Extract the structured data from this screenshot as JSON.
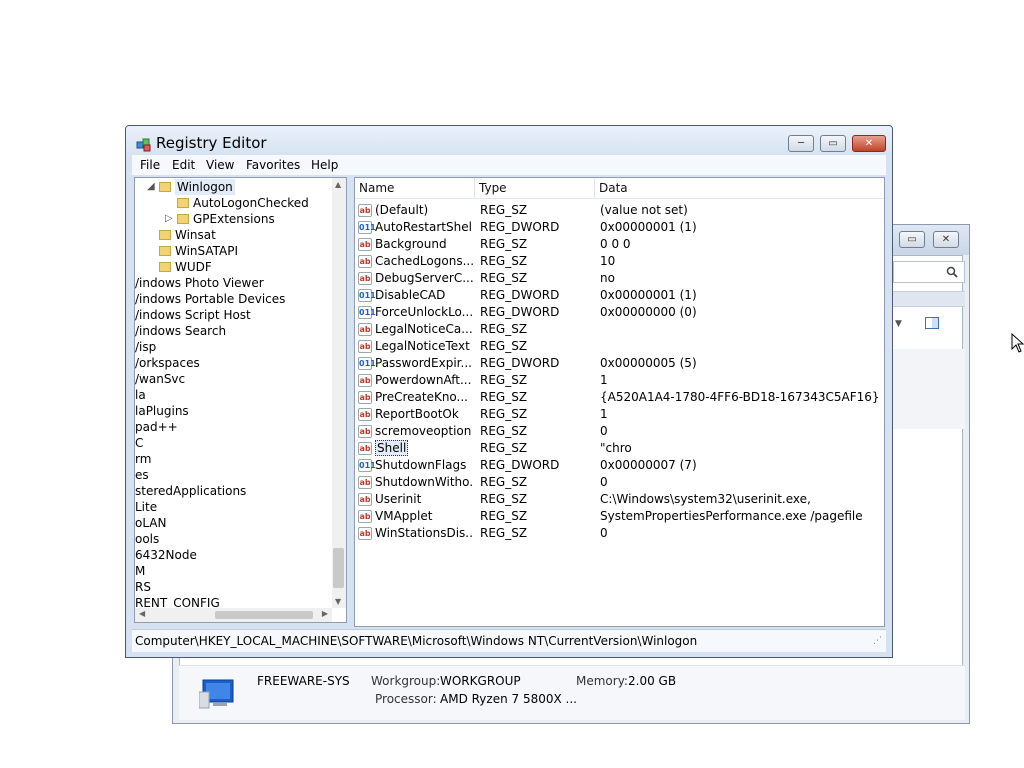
{
  "background_window": {
    "buttons": [
      "▭",
      "✕"
    ],
    "computer_name": "FREEWARE-SYS",
    "workgroup_label": "Workgroup:",
    "workgroup_value": "WORKGROUP",
    "memory_label": "Memory:",
    "memory_value": "2.00 GB",
    "processor_label": "Processor:",
    "processor_value": "AMD Ryzen 7 5800X ..."
  },
  "registry_editor": {
    "title": "Registry Editor",
    "title_buttons": [
      "─",
      "▭",
      "✕"
    ],
    "menu": [
      "File",
      "Edit",
      "View",
      "Favorites",
      "Help"
    ],
    "tree": [
      {
        "label": "Winlogon",
        "indent": 1,
        "folder": true,
        "expanded": true,
        "selected": true
      },
      {
        "label": "AutoLogonChecked",
        "indent": 2,
        "folder": true
      },
      {
        "label": "GPExtensions",
        "indent": 2,
        "folder": true,
        "collapsed": true
      },
      {
        "label": "Winsat",
        "indent": 1,
        "folder": true
      },
      {
        "label": "WinSATAPI",
        "indent": 1,
        "folder": true
      },
      {
        "label": "WUDF",
        "indent": 1,
        "folder": true
      },
      {
        "label": "/indows Photo Viewer",
        "indent": 0
      },
      {
        "label": "/indows Portable Devices",
        "indent": 0
      },
      {
        "label": "/indows Script Host",
        "indent": 0
      },
      {
        "label": "/indows Search",
        "indent": 0
      },
      {
        "label": "/isp",
        "indent": 0
      },
      {
        "label": "/orkspaces",
        "indent": 0
      },
      {
        "label": "/wanSvc",
        "indent": 0
      },
      {
        "label": "la",
        "indent": 0
      },
      {
        "label": "laPlugins",
        "indent": 0
      },
      {
        "label": "pad++",
        "indent": 0
      },
      {
        "label": "C",
        "indent": 0
      },
      {
        "label": "rm",
        "indent": 0
      },
      {
        "label": "es",
        "indent": 0
      },
      {
        "label": "steredApplications",
        "indent": 0
      },
      {
        "label": " Lite",
        "indent": 0
      },
      {
        "label": "oLAN",
        "indent": 0
      },
      {
        "label": "ools",
        "indent": 0
      },
      {
        "label": "6432Node",
        "indent": 0
      },
      {
        "label": "M",
        "indent": 0
      },
      {
        "label": "RS",
        "indent": 0
      },
      {
        "label": "RENT_CONFIG",
        "indent": 0
      }
    ],
    "columns": [
      "Name",
      "Type",
      "Data"
    ],
    "values": [
      {
        "name": "(Default)",
        "type": "REG_SZ",
        "data": "(value not set)",
        "icon": "ab"
      },
      {
        "name": "AutoRestartShell",
        "type": "REG_DWORD",
        "data": "0x00000001 (1)",
        "icon": "dw"
      },
      {
        "name": "Background",
        "type": "REG_SZ",
        "data": "0 0 0",
        "icon": "ab"
      },
      {
        "name": "CachedLogons...",
        "type": "REG_SZ",
        "data": "10",
        "icon": "ab"
      },
      {
        "name": "DebugServerC...",
        "type": "REG_SZ",
        "data": "no",
        "icon": "ab"
      },
      {
        "name": "DisableCAD",
        "type": "REG_DWORD",
        "data": "0x00000001 (1)",
        "icon": "dw"
      },
      {
        "name": "ForceUnlockLo...",
        "type": "REG_DWORD",
        "data": "0x00000000 (0)",
        "icon": "dw"
      },
      {
        "name": "LegalNoticeCa...",
        "type": "REG_SZ",
        "data": "",
        "icon": "ab"
      },
      {
        "name": "LegalNoticeText",
        "type": "REG_SZ",
        "data": "",
        "icon": "ab"
      },
      {
        "name": "PasswordExpir...",
        "type": "REG_DWORD",
        "data": "0x00000005 (5)",
        "icon": "dw"
      },
      {
        "name": "PowerdownAft...",
        "type": "REG_SZ",
        "data": "1",
        "icon": "ab"
      },
      {
        "name": "PreCreateKno...",
        "type": "REG_SZ",
        "data": "{A520A1A4-1780-4FF6-BD18-167343C5AF16}",
        "icon": "ab"
      },
      {
        "name": "ReportBootOk",
        "type": "REG_SZ",
        "data": "1",
        "icon": "ab"
      },
      {
        "name": "scremoveoption",
        "type": "REG_SZ",
        "data": "0",
        "icon": "ab"
      },
      {
        "name": "Shell",
        "type": "REG_SZ",
        "data": "\"chro",
        "icon": "ab",
        "selected": true
      },
      {
        "name": "ShutdownFlags",
        "type": "REG_DWORD",
        "data": "0x00000007 (7)",
        "icon": "dw"
      },
      {
        "name": "ShutdownWitho...",
        "type": "REG_SZ",
        "data": "0",
        "icon": "ab"
      },
      {
        "name": "Userinit",
        "type": "REG_SZ",
        "data": "C:\\Windows\\system32\\userinit.exe,",
        "icon": "ab"
      },
      {
        "name": "VMApplet",
        "type": "REG_SZ",
        "data": "SystemPropertiesPerformance.exe /pagefile",
        "icon": "ab"
      },
      {
        "name": "WinStationsDis...",
        "type": "REG_SZ",
        "data": "0",
        "icon": "ab"
      }
    ],
    "status_path": "Computer\\HKEY_LOCAL_MACHINE\\SOFTWARE\\Microsoft\\Windows NT\\CurrentVersion\\Winlogon"
  },
  "colors": {
    "selection": "#e2ebf7",
    "folder": "#f2d374",
    "string_icon": "#c0392b",
    "dword_icon": "#1f5fbf"
  }
}
